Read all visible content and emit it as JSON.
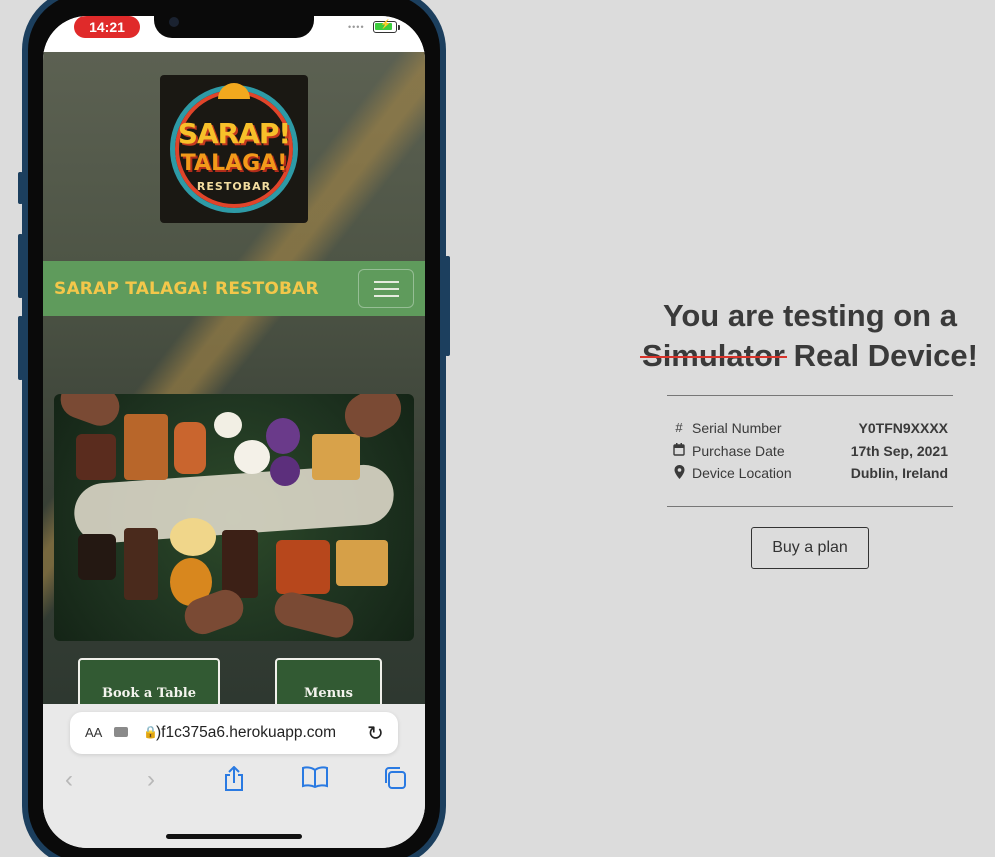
{
  "status_bar": {
    "time": "14:21"
  },
  "site": {
    "logo": {
      "line1": "SARAP!",
      "line2": "TALAGA!",
      "line3": "RESTOBAR"
    },
    "brand": "SARAP TALAGA! RESTOBAR",
    "buttons": {
      "book": "Book a Table",
      "menus": "Menus"
    }
  },
  "safari": {
    "aa": "AA",
    "url": ")f1c375a6.herokuapp.com"
  },
  "info_panel": {
    "title_line1": "You are testing on a",
    "strike_word": "Simulator",
    "title_rest": " Real Device!",
    "rows": [
      {
        "icon": "#",
        "label": "Serial Number",
        "value": "Y0TFN9XXXX"
      },
      {
        "icon": "calendar-icon",
        "label": "Purchase Date",
        "value": "17th Sep, 2021"
      },
      {
        "icon": "location-pin-icon",
        "label": "Device Location",
        "value": "Dublin, Ireland"
      }
    ],
    "buy_label": "Buy a plan"
  },
  "colors": {
    "navbar": "#5f9b5c",
    "brand": "#f3c74a",
    "cta": "#325a33",
    "time_pill": "#e02a2a",
    "strike": "#d9342b"
  }
}
